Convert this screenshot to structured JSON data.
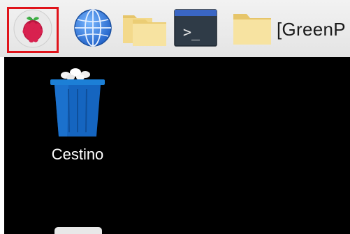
{
  "taskbar": {
    "menu": {
      "icon": "raspberry-pi-icon"
    },
    "browser": {
      "icon": "globe-icon"
    },
    "files": {
      "icon": "folder-icon"
    },
    "terminal": {
      "icon": "terminal-icon",
      "glyph": ">_"
    },
    "window": {
      "icon": "folder-icon",
      "label": "[GreenP"
    }
  },
  "desktop": {
    "items": [
      {
        "label": "Cestino",
        "icon": "trash-icon"
      },
      {
        "label": "",
        "icon": "file-icon"
      }
    ]
  },
  "colors": {
    "taskbar_bg": "#ececec",
    "desktop_bg": "#000000",
    "highlight": "#e0141b",
    "trash_blue": "#1565c0",
    "folder_yellow": "#f5d77e",
    "raspberry_red": "#c51a4a"
  }
}
